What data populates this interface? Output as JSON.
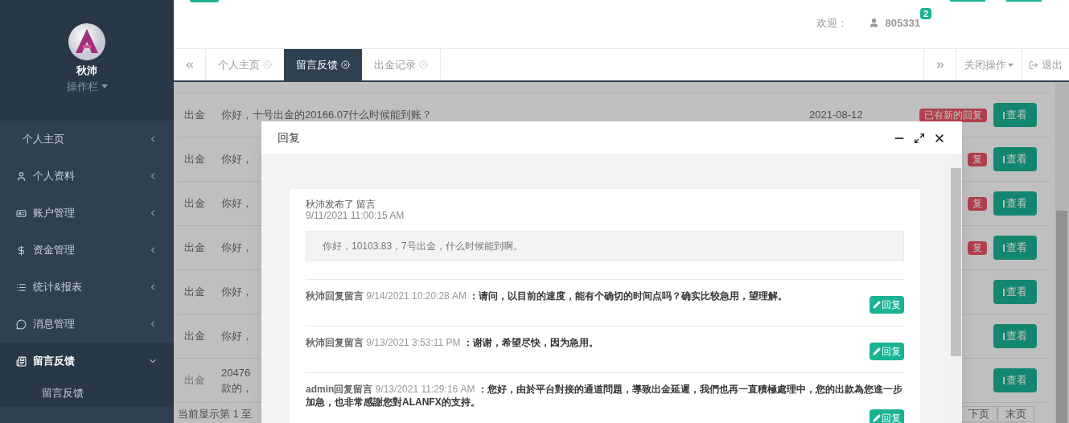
{
  "sidebar": {
    "user_name": "秋沛",
    "menu_label": "操作栏",
    "items": [
      {
        "label": "个人主页",
        "selected": false,
        "expanded": false
      },
      {
        "label": "个人资料",
        "selected": false,
        "expanded": false
      },
      {
        "label": "账户管理",
        "selected": false,
        "expanded": false
      },
      {
        "label": "资金管理",
        "selected": false,
        "expanded": false
      },
      {
        "label": "统计&报表",
        "selected": false,
        "expanded": false
      },
      {
        "label": "消息管理",
        "selected": false,
        "expanded": false
      },
      {
        "label": "留言反馈",
        "selected": true,
        "expanded": true,
        "children": [
          {
            "label": "留言反馈"
          }
        ]
      }
    ]
  },
  "header": {
    "welcome": "欢迎：",
    "user": "805331",
    "badge": "2"
  },
  "tabs": [
    {
      "label": "个人主页",
      "selected": false
    },
    {
      "label": "留言反馈",
      "selected": true
    },
    {
      "label": "出金记录",
      "selected": false
    }
  ],
  "tab_actions": {
    "close_menu": "关闭操作",
    "logout": "退出"
  },
  "table": {
    "rows": [
      {
        "type": "出金",
        "message": "你好，十号出金的20166.07什么时候能到账？",
        "date": "2021-08-12",
        "badge": "已有新的回复",
        "button": "查看"
      },
      {
        "type": "出金",
        "message": "你好，",
        "badge": "复",
        "button": "查看"
      },
      {
        "type": "出金",
        "message": "你好，",
        "badge": "复",
        "button": "查看"
      },
      {
        "type": "出金",
        "message": "你好，",
        "badge": "复",
        "button": "查看"
      },
      {
        "type": "出金",
        "message": "你好，",
        "button": "查看"
      },
      {
        "type": "出金",
        "message": "你好，",
        "button": "查看"
      },
      {
        "type": "出金",
        "message": "20476",
        "message_line2": "款的，",
        "button": "查看"
      }
    ]
  },
  "footer": {
    "info": "当前显示第 1 至",
    "pages": [
      "下页",
      "末页"
    ]
  },
  "modal": {
    "title": "回复",
    "post": {
      "author": "秋沛发布了 留言",
      "time": "9/11/2021 11:00:15 AM",
      "content": "你好，10103.83，7号出金，什么时候能到啊。"
    },
    "replies": [
      {
        "author": "秋沛回复留言",
        "time": "9/14/2021 10:20:28 AM",
        "separator": "：",
        "text": "请问，以目前的速度，能有个确切的时间点吗？确实比较急用，望理解。",
        "button": "回复"
      },
      {
        "author": "秋沛回复留言",
        "time": "9/13/2021 3:53:11 PM",
        "separator": "：",
        "text": "谢谢，希望尽快，因为急用。",
        "button": "回复"
      },
      {
        "author": "admin回复留言",
        "time": "9/13/2021 11:29:16 AM",
        "separator": "：",
        "text": "您好，由於平台對接的通道問題，導致出金延遲，我們也再一直積極處理中，您的出款為您進一步加急，也非常感謝您對ALANFX的支持。",
        "button": "回复"
      }
    ]
  }
}
